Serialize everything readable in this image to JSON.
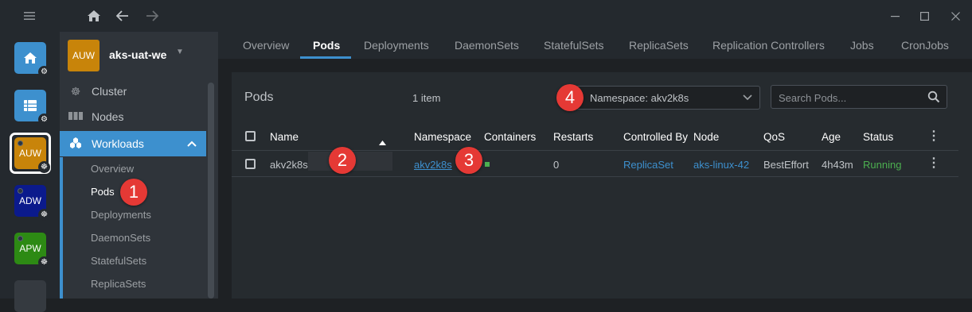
{
  "titlebar": {
    "menu_icon": "hamburger-icon",
    "home_icon": "home-icon",
    "back_icon": "arrow-left-icon",
    "forward_icon": "arrow-right-icon"
  },
  "window_controls": {
    "minimize": "minimize-icon",
    "maximize": "maximize-icon",
    "close": "close-icon"
  },
  "hotbar": {
    "clusters": [
      {
        "label": "AUW",
        "color": "#c8840a"
      },
      {
        "label": "ADW",
        "color": "#0b1a8c"
      },
      {
        "label": "APW",
        "color": "#2d8a14"
      }
    ]
  },
  "sidebar": {
    "avatar": "AUW",
    "cluster_name": "aks-uat-we",
    "items": [
      {
        "label": "Cluster",
        "icon": "helm-icon"
      },
      {
        "label": "Nodes",
        "icon": "server-icon"
      },
      {
        "label": "Workloads",
        "icon": "workloads-icon"
      }
    ],
    "sub_items": [
      "Overview",
      "Pods",
      "Deployments",
      "DaemonSets",
      "StatefulSets",
      "ReplicaSets"
    ]
  },
  "tabs": [
    "Overview",
    "Pods",
    "Deployments",
    "DaemonSets",
    "StatefulSets",
    "ReplicaSets",
    "Replication Controllers",
    "Jobs",
    "CronJobs"
  ],
  "panel": {
    "title": "Pods",
    "count": "1 item",
    "namespace_select": "Namespace: akv2k8s",
    "search_placeholder": "Search Pods..."
  },
  "table": {
    "headers": [
      "Name",
      "Namespace",
      "Containers",
      "Restarts",
      "Controlled By",
      "Node",
      "QoS",
      "Age",
      "Status"
    ],
    "rows": [
      {
        "name": "akv2k8s",
        "namespace": "akv2k8s",
        "restarts": "0",
        "controlled_by": "ReplicaSet",
        "node": "aks-linux-42",
        "qos": "BestEffort",
        "age": "4h43m",
        "status": "Running"
      }
    ]
  },
  "callouts": [
    "1",
    "2",
    "3",
    "4"
  ],
  "colors": {
    "accent": "#3d90ce",
    "running": "#4caf50",
    "callout": "#e53935"
  }
}
